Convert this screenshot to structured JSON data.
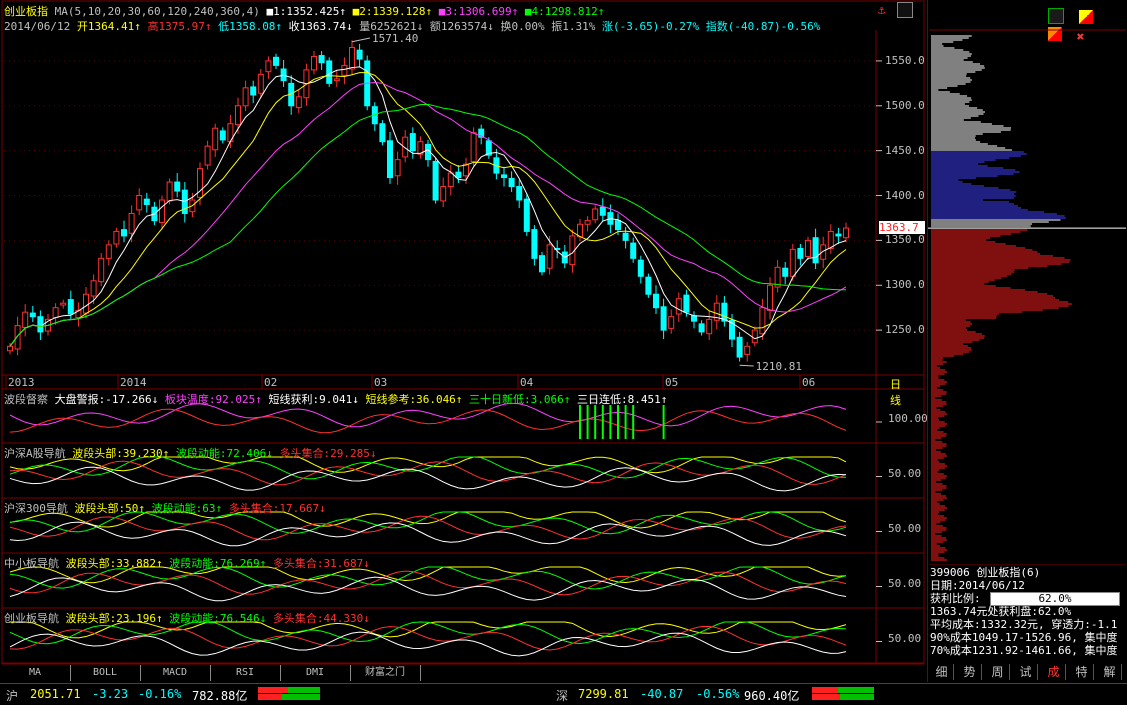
{
  "header": {
    "line1": [
      {
        "text": "创业板指",
        "color": "#ffff00"
      },
      {
        "text": " MA(5,10,20,30,60,120,240,360,4) ",
        "color": "#c0c0c0"
      },
      {
        "text": "■1:1352.425↑",
        "color": "#ffffff"
      },
      {
        "text": " ■2:1339.128↑",
        "color": "#ffff00"
      },
      {
        "text": " ■3:1306.699↑",
        "color": "#ff40ff"
      },
      {
        "text": " ■4:1298.812↑",
        "color": "#00ff00"
      }
    ],
    "line2": [
      {
        "text": "2014/06/12 ",
        "color": "#c0c0c0"
      },
      {
        "text": "开1364.41↑",
        "color": "#ffff00"
      },
      {
        "text": " 高1375.97↑",
        "color": "#ff3030"
      },
      {
        "text": " 低1358.08↑",
        "color": "#00ffff"
      },
      {
        "text": " 收1363.74↓",
        "color": "#ffffff"
      },
      {
        "text": " 量6252621↓ 额1263574↓ 换0.00% 振1.31%",
        "color": "#c0c0c0"
      },
      {
        "text": " 涨(-3.65)-0.27%",
        "color": "#00ffff"
      },
      {
        "text": " 指数(-40.87)-0.56%",
        "color": "#00ffff"
      }
    ]
  },
  "price_axis": {
    "labels": [
      "1550.0",
      "1500.0",
      "1450.0",
      "1400.0",
      "1350.0",
      "1300.0",
      "1250.0"
    ],
    "current": "1363.7",
    "high_mark": "1571.40",
    "low_mark": "1210.81"
  },
  "time_axis": {
    "labels": [
      "2013",
      "2014",
      "02",
      "03",
      "04",
      "05",
      "06"
    ],
    "period": "日线"
  },
  "panels": [
    {
      "items": [
        {
          "text": "波段督察",
          "color": "#c0c0c0"
        },
        {
          "text": " 大盘警报:-17.266↓",
          "color": "#ffffff"
        },
        {
          "text": " 板块温度:92.025↑",
          "color": "#ff40ff"
        },
        {
          "text": " 短线获利:9.041↓",
          "color": "#ffffff"
        },
        {
          "text": " 短线参考:36.046↑",
          "color": "#ffff00"
        },
        {
          "text": " 三十日新低:3.066↑",
          "color": "#00ff00"
        },
        {
          "text": " 三日连低:8.451↑",
          "color": "#ffffff"
        }
      ],
      "axis": "100.00"
    },
    {
      "items": [
        {
          "text": "沪深A股导航",
          "color": "#c0c0c0"
        },
        {
          "text": " 波段头部:39.230↑",
          "color": "#ffff00"
        },
        {
          "text": " 波段动能:72.406↓",
          "color": "#00ff00"
        },
        {
          "text": " 多头集合:29.285↓",
          "color": "#ff3030"
        }
      ],
      "axis": "50.00"
    },
    {
      "items": [
        {
          "text": "沪深300导航",
          "color": "#c0c0c0"
        },
        {
          "text": " 波段头部:50↑",
          "color": "#ffff00"
        },
        {
          "text": " 波段动能:63↑",
          "color": "#00ff00"
        },
        {
          "text": " 多头集合:17.667↓",
          "color": "#ff3030"
        }
      ],
      "axis": "50.00"
    },
    {
      "items": [
        {
          "text": "中小板导航",
          "color": "#c0c0c0"
        },
        {
          "text": "  波段头部:33.882↑",
          "color": "#ffff00"
        },
        {
          "text": " 波段动能:76.269↑",
          "color": "#00ff00"
        },
        {
          "text": " 多头集合:31.687↓",
          "color": "#ff3030"
        }
      ],
      "axis": "50.00"
    },
    {
      "items": [
        {
          "text": "创业板导航",
          "color": "#c0c0c0"
        },
        {
          "text": "  波段头部:23.196↑",
          "color": "#ffff00"
        },
        {
          "text": " 波段动能:76.546↓",
          "color": "#00ff00"
        },
        {
          "text": " 多头集合:44.330↓",
          "color": "#ff3030"
        }
      ],
      "axis": "50.00"
    }
  ],
  "tabs": [
    "MA",
    "BOLL",
    "MACD",
    "RSI",
    "DMI",
    "财富之门"
  ],
  "sidebar": {
    "code_line": "399006 创业板指(6)",
    "date_line": "日期:2014/06/12",
    "profit_label": "获利比例:",
    "profit_value": "62.0%",
    "lines": [
      "1363.74元处获利盘:62.0%",
      "平均成本:1332.32元, 穿透力:-1.1",
      "90%成本1049.17-1526.96, 集中度",
      "70%成本1231.92-1461.66, 集中度"
    ],
    "bottom_tabs": [
      "细",
      "势",
      "周",
      "试",
      "成",
      "特",
      "解"
    ],
    "active_tab": "成"
  },
  "status": {
    "sh_label": "沪",
    "sh_value": "2051.71",
    "sh_change": "-3.23",
    "sh_pct": "-0.16%",
    "sh_amount": "782.88亿",
    "sz_label": "深",
    "sz_value": "7299.81",
    "sz_change": "-40.87",
    "sz_pct": "-0.56%",
    "sz_amount": "960.40亿"
  },
  "colors": {
    "up": "#ff3030",
    "down": "#00ffff",
    "ma1": "#ffffff",
    "ma2": "#ffff00",
    "ma3": "#ff40ff",
    "ma4": "#00ff00",
    "grid": "#7a0000"
  },
  "chart_data": {
    "type": "candlestick",
    "title": "创业板指",
    "ylim": [
      1200,
      1580
    ],
    "x_labels": [
      "2013",
      "2014",
      "02",
      "03",
      "04",
      "05",
      "06"
    ],
    "closes": [
      1232,
      1255,
      1270,
      1265,
      1248,
      1262,
      1275,
      1280,
      1268,
      1272,
      1290,
      1305,
      1330,
      1345,
      1360,
      1355,
      1380,
      1400,
      1390,
      1372,
      1395,
      1415,
      1405,
      1380,
      1395,
      1430,
      1455,
      1475,
      1462,
      1480,
      1500,
      1520,
      1512,
      1535,
      1550,
      1545,
      1528,
      1500,
      1510,
      1540,
      1555,
      1548,
      1525,
      1530,
      1545,
      1565,
      1552,
      1500,
      1480,
      1460,
      1420,
      1440,
      1465,
      1450,
      1460,
      1440,
      1395,
      1410,
      1425,
      1420,
      1435,
      1470,
      1465,
      1445,
      1425,
      1420,
      1410,
      1395,
      1360,
      1330,
      1315,
      1345,
      1340,
      1325,
      1355,
      1368,
      1372,
      1385,
      1378,
      1368,
      1362,
      1350,
      1330,
      1310,
      1290,
      1275,
      1250,
      1265,
      1285,
      1270,
      1260,
      1248,
      1262,
      1280,
      1260,
      1240,
      1220,
      1232,
      1250,
      1275,
      1300,
      1320,
      1310,
      1340,
      1330,
      1350,
      1325,
      1345,
      1360,
      1355,
      1363.74
    ],
    "ma_values": {
      "ma5": 1352.425,
      "ma10": 1339.128,
      "ma20": 1306.699,
      "ma30": 1298.812
    },
    "high": 1571.4,
    "low": 1210.81
  }
}
